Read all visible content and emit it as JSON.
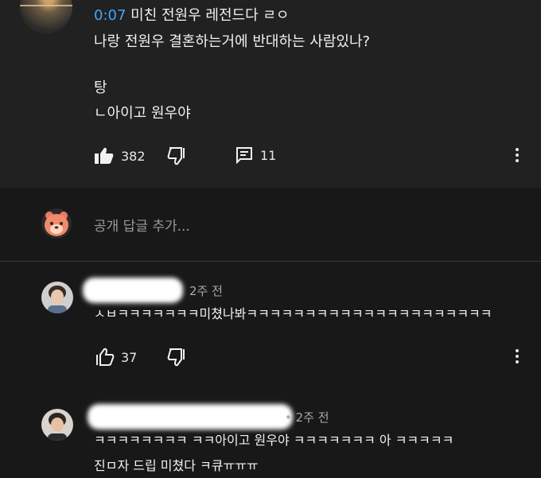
{
  "top_comment": {
    "timestamp_link": "0:07",
    "line1_rest": " 미친 전원우 레전드다 ㄹㅇ",
    "line2": "나랑 전원우 결혼하는거에 반대하는 사람있나?",
    "line3": "탕",
    "line4": "ㄴ아이고 원우야",
    "like_count": "382",
    "reply_count": "11"
  },
  "reply_input": {
    "placeholder": "공개 답글 추가..."
  },
  "replies": [
    {
      "time": "2주 전",
      "text": "ㅅㅂㅋㅋㅋㅋㅋㅋㅋ미쳤나봐ㅋㅋㅋㅋㅋㅋㅋㅋㅋㅋㅋㅋㅋㅋㅋㅋㅋㅋㅋㅋㅋ",
      "like_count": "37"
    },
    {
      "time": "• 2주 전",
      "text_line1": "ㅋㅋㅋㅋㅋㅋㅋㅋ ㅋㅋ아이고 원우야 ㅋㅋㅋㅋㅋㅋㅋ 아 ㅋㅋㅋㅋㅋ",
      "text_line2": "진ㅁ자 드립 미쳤다 ㅋ큐ㅠㅠㅠ"
    }
  ],
  "colors": {
    "link": "#3ea6ff",
    "bg": "#181818",
    "panel": "#212121"
  }
}
